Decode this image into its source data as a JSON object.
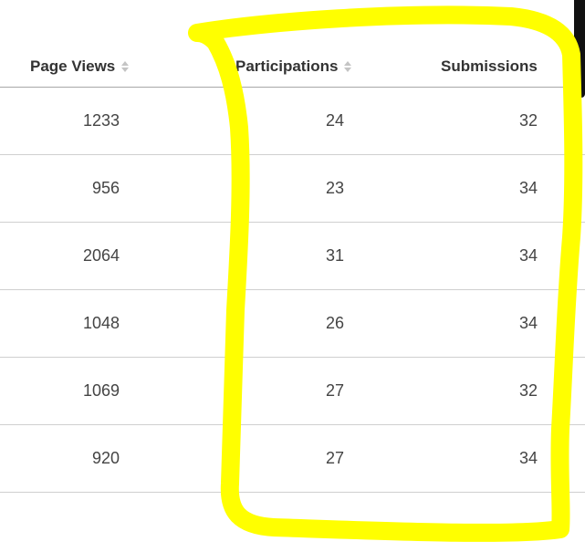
{
  "table": {
    "columns": [
      {
        "label": "Page Views",
        "sortable": true
      },
      {
        "label": "Participations",
        "sortable": true
      },
      {
        "label": "Submissions",
        "sortable": false
      }
    ],
    "rows": [
      {
        "page_views": "1233",
        "participations": "24",
        "submissions": "32"
      },
      {
        "page_views": "956",
        "participations": "23",
        "submissions": "34"
      },
      {
        "page_views": "2064",
        "participations": "31",
        "submissions": "34"
      },
      {
        "page_views": "1048",
        "participations": "26",
        "submissions": "34"
      },
      {
        "page_views": "1069",
        "participations": "27",
        "submissions": "32"
      },
      {
        "page_views": "920",
        "participations": "27",
        "submissions": "34"
      }
    ]
  },
  "annotation": {
    "color": "#ffff00"
  }
}
